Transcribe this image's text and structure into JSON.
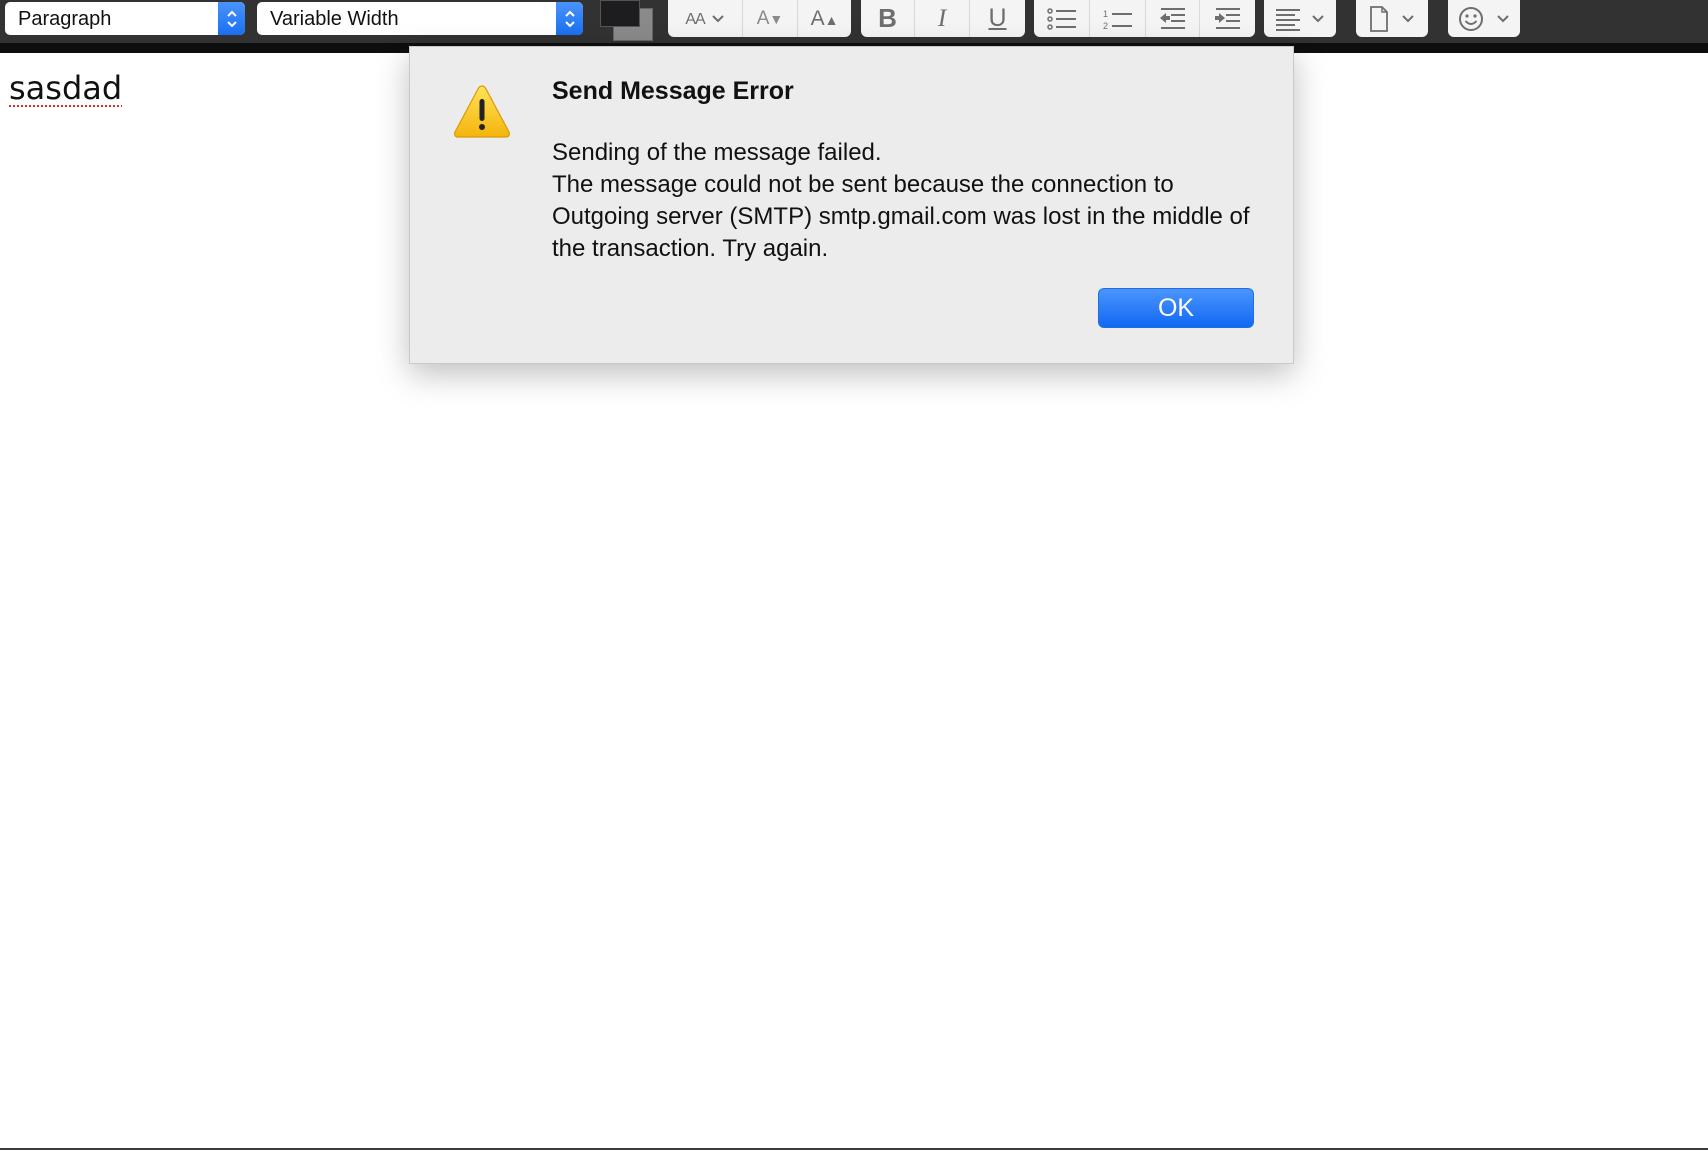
{
  "toolbar": {
    "paragraph_select": {
      "value": "Paragraph"
    },
    "font_select": {
      "value": "Variable Width"
    },
    "colors": {
      "text_color": "#1d1d1f",
      "background_color": "#8a8a8a"
    },
    "buttons": {
      "font_size": {
        "icon": "font-size-icon",
        "label": "AA"
      },
      "smaller_text": {
        "icon": "decrease-font-icon",
        "label": "A"
      },
      "larger_text": {
        "icon": "increase-font-icon",
        "label": "A"
      },
      "bold": {
        "icon": "bold-icon",
        "label": "B"
      },
      "italic": {
        "icon": "italic-icon",
        "label": "I"
      },
      "underline": {
        "icon": "underline-icon",
        "label": "U"
      },
      "bullet_list": {
        "icon": "bullet-list-icon"
      },
      "numbered_list": {
        "icon": "numbered-list-icon",
        "numbers": [
          "1",
          "2"
        ]
      },
      "outdent": {
        "icon": "outdent-icon"
      },
      "indent": {
        "icon": "indent-icon"
      },
      "align": {
        "icon": "align-left-icon"
      },
      "insert": {
        "icon": "page-icon"
      },
      "emoji": {
        "icon": "smiley-icon"
      }
    }
  },
  "editor": {
    "body_text": "sasdad"
  },
  "dialog": {
    "title": "Send Message Error",
    "message_line1": "Sending of the message failed.",
    "message_line2": "The message could not be sent because the connection to Outgoing server (SMTP) smtp.gmail.com was lost in the middle of the transaction. Try again.",
    "icon": "warning-icon",
    "ok_label": "OK",
    "accent_color": "#1a6ff0"
  }
}
